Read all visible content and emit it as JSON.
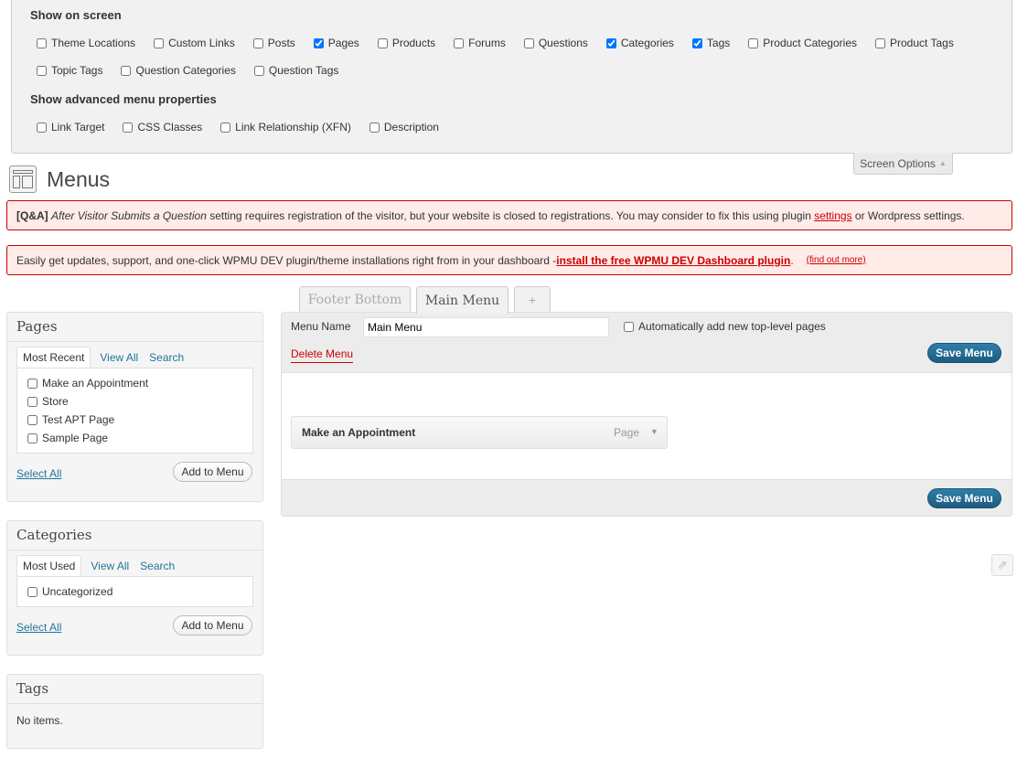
{
  "screen_options": {
    "show_on_screen_heading": "Show on screen",
    "show_on_screen_items": [
      {
        "label": "Theme Locations",
        "checked": false
      },
      {
        "label": "Custom Links",
        "checked": false
      },
      {
        "label": "Posts",
        "checked": false
      },
      {
        "label": "Pages",
        "checked": true
      },
      {
        "label": "Products",
        "checked": false
      },
      {
        "label": "Forums",
        "checked": false
      },
      {
        "label": "Questions",
        "checked": false
      },
      {
        "label": "Categories",
        "checked": true
      },
      {
        "label": "Tags",
        "checked": true
      },
      {
        "label": "Product Categories",
        "checked": false
      },
      {
        "label": "Product Tags",
        "checked": false
      },
      {
        "label": "Topic Tags",
        "checked": false
      },
      {
        "label": "Question Categories",
        "checked": false
      },
      {
        "label": "Question Tags",
        "checked": false
      }
    ],
    "advanced_heading": "Show advanced menu properties",
    "advanced_items": [
      {
        "label": "Link Target",
        "checked": false
      },
      {
        "label": "CSS Classes",
        "checked": false
      },
      {
        "label": "Link Relationship (XFN)",
        "checked": false
      },
      {
        "label": "Description",
        "checked": false
      }
    ],
    "tab_label": "Screen Options",
    "tab_arrow": "▲"
  },
  "page": {
    "title": "Menus"
  },
  "notice_qa": {
    "prefix": "[Q&A]",
    "setting": "After Visitor Submits a Question",
    "text": " setting requires registration of the visitor, but your website is closed to registrations. You may consider to fix this using plugin ",
    "link": "settings",
    "suffix": " or Wordpress settings."
  },
  "notice_wpmu": {
    "text": "Easily get updates, support, and one-click WPMU DEV plugin/theme installations right from in your dashboard - ",
    "link": "install the free WPMU DEV Dashboard plugin",
    "period": ".",
    "find_out": "(find out more)"
  },
  "menu_tabs": {
    "footer": "Footer Bottom",
    "main": "Main Menu",
    "add": "+"
  },
  "pages_box": {
    "title": "Pages",
    "tabs": [
      "Most Recent",
      "View All",
      "Search"
    ],
    "items": [
      "Make an Appointment",
      "Store",
      "Test APT Page",
      "Sample Page"
    ],
    "select_all": "Select All",
    "add_button": "Add to Menu"
  },
  "categories_box": {
    "title": "Categories",
    "tabs": [
      "Most Used",
      "View All",
      "Search"
    ],
    "items": [
      "Uncategorized"
    ],
    "select_all": "Select All",
    "add_button": "Add to Menu"
  },
  "tags_box": {
    "title": "Tags",
    "empty": "No items."
  },
  "menu_editor": {
    "name_label": "Menu Name",
    "name_value": "Main Menu",
    "auto_add_label": "Automatically add new top-level pages",
    "delete_label": "Delete Menu",
    "save_label": "Save Menu",
    "items": [
      {
        "title": "Make an Appointment",
        "type": "Page"
      }
    ]
  }
}
